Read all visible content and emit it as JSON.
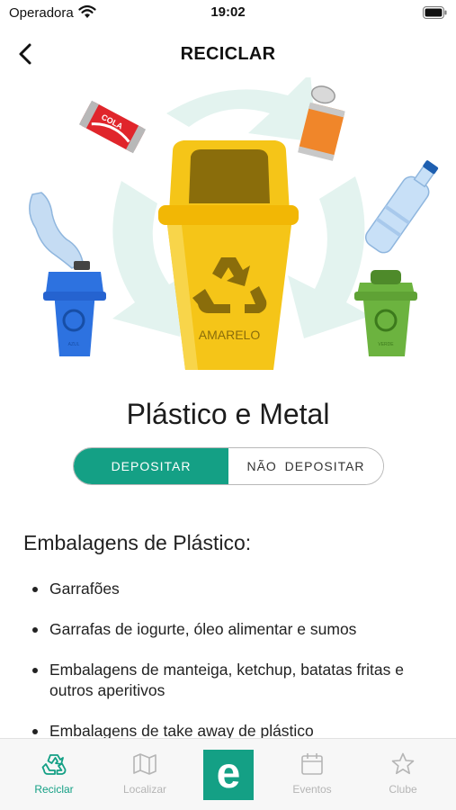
{
  "status_bar": {
    "carrier": "Operadora",
    "time": "19:02"
  },
  "header": {
    "title": "RECICLAR",
    "back_icon": "chevron-left-icon"
  },
  "illustration": {
    "main_bin_label": "AMARELO",
    "can_label": "COLA",
    "blue_bin_label": "AZUL",
    "green_bin_label": "VERDE"
  },
  "category": {
    "title": "Plástico e Metal"
  },
  "toggle": {
    "active_label": "DEPOSITAR",
    "inactive_label": "NÃO DEPOSITAR"
  },
  "section": {
    "heading": "Embalagens de Plástico:",
    "items": [
      "Garrafões",
      "Garrafas de iogurte, óleo alimentar e sumos",
      "Embalagens de manteiga, ketchup, batatas fritas e outros aperitivos",
      "Embalagens de take away de plástico"
    ]
  },
  "tab_bar": {
    "tabs": [
      {
        "label": "Reciclar",
        "icon": "recycle-icon",
        "active": true
      },
      {
        "label": "Localizar",
        "icon": "map-icon",
        "active": false
      },
      {
        "label": "Eventos",
        "icon": "calendar-icon",
        "active": false
      },
      {
        "label": "Clube",
        "icon": "star-icon",
        "active": false
      }
    ],
    "center_label": "e"
  },
  "colors": {
    "accent": "#14a085",
    "yellow_bin": "#f5c518",
    "blue_bin": "#2d72e0",
    "green_bin": "#6cb33f"
  }
}
